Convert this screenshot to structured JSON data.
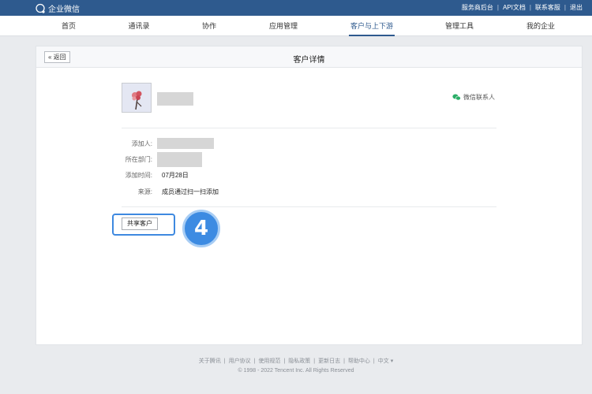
{
  "topbar": {
    "brand_name": "企业微信",
    "brand_icon": "wecom-logo-icon",
    "links": [
      "服务商后台",
      "API文档",
      "联系客服",
      "退出"
    ]
  },
  "nav": {
    "items": [
      "首页",
      "通讯录",
      "协作",
      "应用管理",
      "客户与上下游",
      "管理工具",
      "我的企业"
    ],
    "active": "客户与上下游"
  },
  "detail": {
    "back_label": "« 返回",
    "title": "客户详情",
    "wechat_contact_label": "微信联系人",
    "fields": {
      "added_by_label": "添加人:",
      "department_label": "所在部门:",
      "added_time_label": "添加时间:",
      "added_time_value": "07月28日",
      "source_label": "来源:",
      "source_value": "成员通过扫一扫添加"
    },
    "share_button_label": "共享客户",
    "step_number": "4"
  },
  "footer": {
    "links": [
      "关于腾讯",
      "用户协议",
      "使用规范",
      "隐私政策",
      "更新日志",
      "帮助中心",
      "中文 ▾"
    ],
    "copyright": "© 1998 - 2022 Tencent Inc. All Rights Reserved"
  },
  "colors": {
    "topbar": "#2e5a8e",
    "accent": "#3d8be2",
    "wechat_green": "#2aae67"
  }
}
